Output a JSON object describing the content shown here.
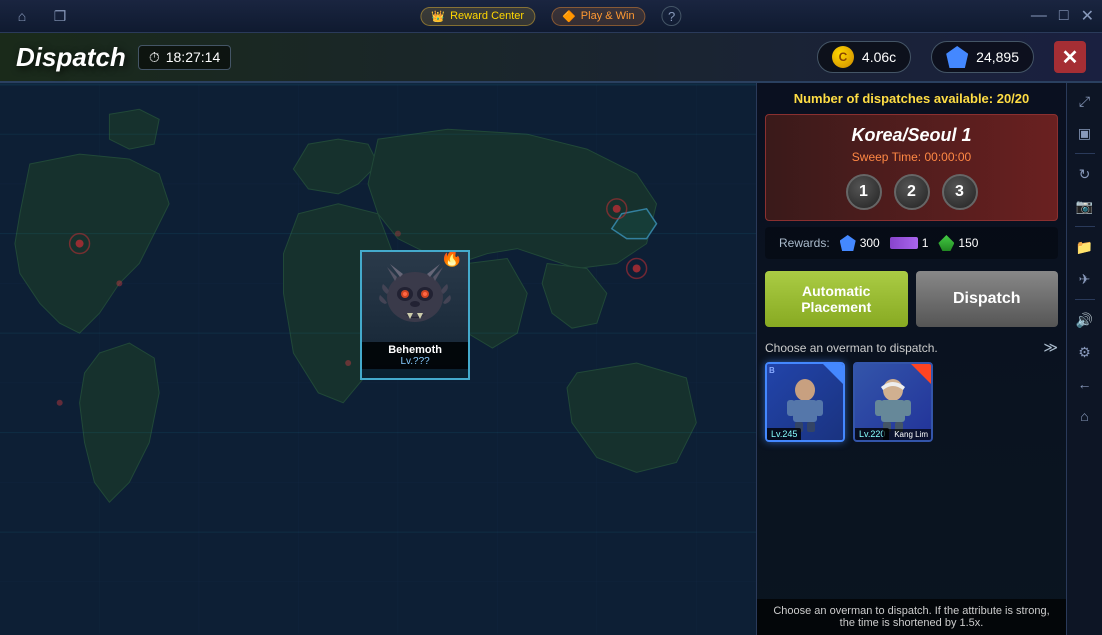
{
  "titlebar": {
    "reward_center_label": "Reward Center",
    "play_win_label": "Play & Win",
    "icons": {
      "home": "⌂",
      "restore": "❐",
      "minimize": "—",
      "maximize": "□",
      "close": "✕",
      "help": "?"
    }
  },
  "header": {
    "dispatch_title": "Dispatch",
    "timer": {
      "icon": "⏱",
      "value": "18:27:14"
    },
    "currency": {
      "coin_value": "4.06c",
      "gem_value": "24,895"
    }
  },
  "map": {
    "dispatches_available": "Number of dispatches available: 20/20",
    "behemoth": {
      "name": "Behemoth",
      "level": "Lv.???"
    }
  },
  "location": {
    "name": "Korea/Seoul 1",
    "sweep_time_label": "Sweep Time:",
    "sweep_time_value": "00:00:00",
    "difficulty_levels": [
      "1",
      "2",
      "3"
    ]
  },
  "rewards": {
    "label": "Rewards:",
    "gem_value": "300",
    "purple_value": "1",
    "green_value": "150"
  },
  "buttons": {
    "auto_placement": "Automatic\nPlacement",
    "dispatch": "Dispatch"
  },
  "overman_section": {
    "label": "Choose an overman to dispatch.",
    "cards": [
      {
        "level": "Lv.245",
        "rarity": "B",
        "name": ""
      },
      {
        "level": "Lv.220",
        "rarity": "",
        "name": "Kang Lim"
      }
    ]
  },
  "bottom_hint": "Choose an overman to dispatch. If the attribute is strong, the time is shortened by 1.5x."
}
